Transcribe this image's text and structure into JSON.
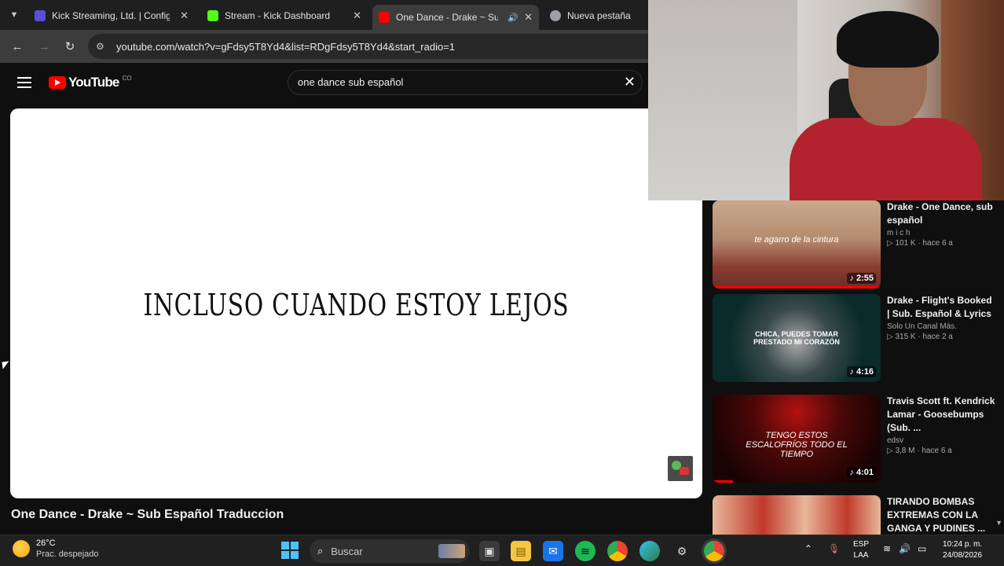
{
  "browser": {
    "tabs": [
      {
        "title": "Kick Streaming, Ltd. | Configu",
        "favicon_color": "#5b4fd6"
      },
      {
        "title": "Stream - Kick Dashboard",
        "favicon_color": "#53fc18"
      },
      {
        "title": "One Dance - Drake ~ Sub",
        "favicon_color": "#ff0000"
      },
      {
        "title": "Nueva pestaña",
        "favicon_color": "#9aa0a6"
      }
    ],
    "url": "youtube.com/watch?v=gFdsy5T8Yd4&list=RDgFdsy5T8Yd4&start_radio=1"
  },
  "youtube": {
    "logo_text": "YouTube",
    "country_code": "CO",
    "search_query": "one dance sub español"
  },
  "video": {
    "lyric": "INCLUSO CUANDO ESTOY LEJOS",
    "title": "One Dance - Drake ~ Sub Español Traduccion"
  },
  "sidebar": {
    "items": [
      {
        "title": "Drake - One Dance, sub español",
        "channel": "m i c h",
        "stats": "▷ 101 K · hace 6 a",
        "duration": "♪ 2:55",
        "thumb_text": "te agarro de la cintura",
        "thumb_colors": [
          "#caa98c",
          "#8b3c2f"
        ],
        "watched_fraction": 1.0
      },
      {
        "title": "Drake - Flight's Booked | Sub. Español & Lyrics",
        "channel": "Solo Un Canal Más.",
        "stats": "▷ 315 K · hace 2 a",
        "duration": "♪ 4:16",
        "thumb_text": "CHICA, PUEDES TOMAR PRESTADO MI CORAZÓN",
        "thumb_colors": [
          "#0b2a2a",
          "#a9a9a9"
        ],
        "watched_fraction": 0
      },
      {
        "title": "Travis Scott ft. Kendrick Lamar - Goosebumps (Sub. ...",
        "channel": "edsv",
        "stats": "▷ 3,8 M · hace 6 a",
        "duration": "♪ 4:01",
        "thumb_text": "TENGO ESTOS ESCALOFRÍOS TODO EL TIEMPO",
        "thumb_colors": [
          "#2a0505",
          "#b31212"
        ],
        "watched_fraction": 0.12
      },
      {
        "title": "TIRANDO BOMBAS EXTREMAS CON LA GANGA Y PUDINES ...",
        "channel": "",
        "stats": "",
        "duration": "",
        "thumb_text": "",
        "thumb_colors": [
          "#c0392b",
          "#e8b89a"
        ],
        "watched_fraction": 0
      }
    ]
  },
  "taskbar": {
    "weather_temp": "26°C",
    "weather_desc": "Prac. despejado",
    "search_label": "Buscar",
    "lang_top": "ESP",
    "lang_bottom": "LAA",
    "time": "10:24 p. m.",
    "date": "24/08/2026"
  }
}
